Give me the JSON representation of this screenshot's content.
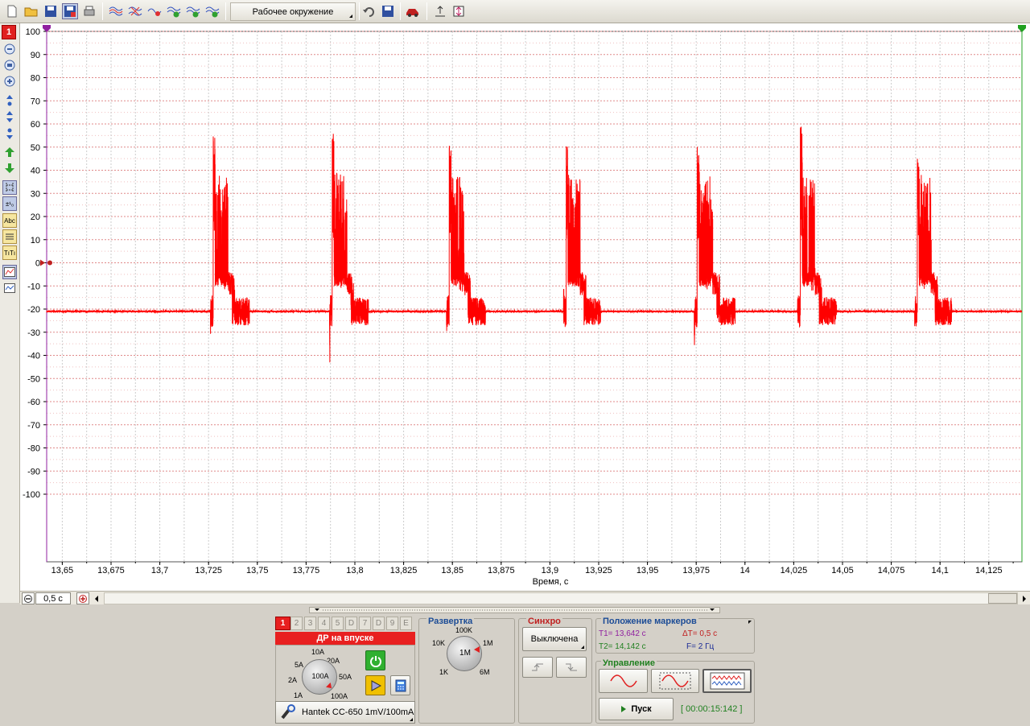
{
  "toolbar": {
    "workspace_label": "Рабочее окружение",
    "icons": [
      "new-file-icon",
      "open-folder-icon",
      "save-icon",
      "save-as-icon",
      "print-icon",
      "wave-a-icon",
      "wave-b-icon",
      "wave-c-icon",
      "wave-d-icon",
      "wave-e-icon",
      "wave-f-icon",
      "undo-icon",
      "save-settings-icon",
      "car-icon",
      "zoom-fit-icon",
      "zoom-center-icon"
    ]
  },
  "left_toolbar": {
    "channel_badge": "1",
    "icons": [
      "zoom-out-icon",
      "zoom-reset-icon",
      "zoom-in-icon",
      "scale-up-icon",
      "scale-mid-icon",
      "scale-down-icon",
      "shift-up-icon",
      "shift-down-icon",
      "cursor-grid-icon",
      "cursor-numbers-icon",
      "text-label-icon",
      "markers-icon",
      "text-style-icon",
      "chart-mode-icon",
      "chart-view-icon"
    ]
  },
  "chart": {
    "y_ticks": [
      "100",
      "90",
      "80",
      "70",
      "60",
      "50",
      "40",
      "30",
      "20",
      "10",
      "0",
      "-10",
      "-20",
      "-30",
      "-40",
      "-50",
      "-60",
      "-70",
      "-80",
      "-90",
      "-100"
    ],
    "x_ticks": [
      "13,65",
      "13,675",
      "13,7",
      "13,725",
      "13,75",
      "13,775",
      "13,8",
      "13,825",
      "13,85",
      "13,875",
      "13,9",
      "13,925",
      "13,95",
      "13,975",
      "14",
      "14,025",
      "14,05",
      "14,075",
      "14,1",
      "14,125"
    ],
    "xlabel": "Время, с",
    "colors": {
      "signal": "#ff0000",
      "grid": "#e08080",
      "marker1": "#9020a0",
      "marker2": "#20a020"
    }
  },
  "chart_data": {
    "type": "line",
    "xlabel": "Время, с",
    "xlim": [
      13.642,
      14.142
    ],
    "ylim": [
      -100,
      100
    ],
    "grid": true,
    "series": [
      {
        "baseline": -21,
        "bursts": [
          {
            "start": 13.726,
            "end": 13.746,
            "peak": 56,
            "min": -34
          },
          {
            "start": 13.787,
            "end": 13.807,
            "peak": 56,
            "min": -44
          },
          {
            "start": 13.847,
            "end": 13.867,
            "peak": 52,
            "min": -31
          },
          {
            "start": 13.907,
            "end": 13.926,
            "peak": 52,
            "min": -29
          },
          {
            "start": 13.974,
            "end": 13.995,
            "peak": 51,
            "min": -43
          },
          {
            "start": 14.027,
            "end": 14.047,
            "peak": 60,
            "min": -30
          },
          {
            "start": 14.087,
            "end": 14.106,
            "peak": 46,
            "min": -31
          }
        ]
      }
    ]
  },
  "hscroll": {
    "zoom_value": "0,5 с"
  },
  "channel_panel": {
    "tabs": [
      "1",
      "2",
      "3",
      "4",
      "5",
      "D",
      "7",
      "D",
      "9",
      "E"
    ],
    "title": "ДР на впуске",
    "knob_labels": [
      "10A",
      "20A",
      "5A",
      "50A",
      "2A",
      "100A",
      "1A",
      "100A"
    ],
    "knob_center": "100A",
    "probe": "Hantek CC-650 1mV/100mA"
  },
  "sweep_panel": {
    "title": "Развертка",
    "knob_labels": [
      "100K",
      "10K",
      "1M",
      "1K",
      "6M"
    ],
    "knob_center": "1M"
  },
  "sync_panel": {
    "title": "Синхро",
    "mode": "Выключена"
  },
  "markers_panel": {
    "title": "Положение маркеров",
    "t1": "T1= 13,642 с",
    "t2": "T2= 14,142 с",
    "dt": "ΔT= 0,5 с",
    "freq": "F= 2 Гц"
  },
  "control_panel": {
    "title": "Управление",
    "start": "Пуск",
    "timer": "[ 00:00:15:142 ]"
  }
}
